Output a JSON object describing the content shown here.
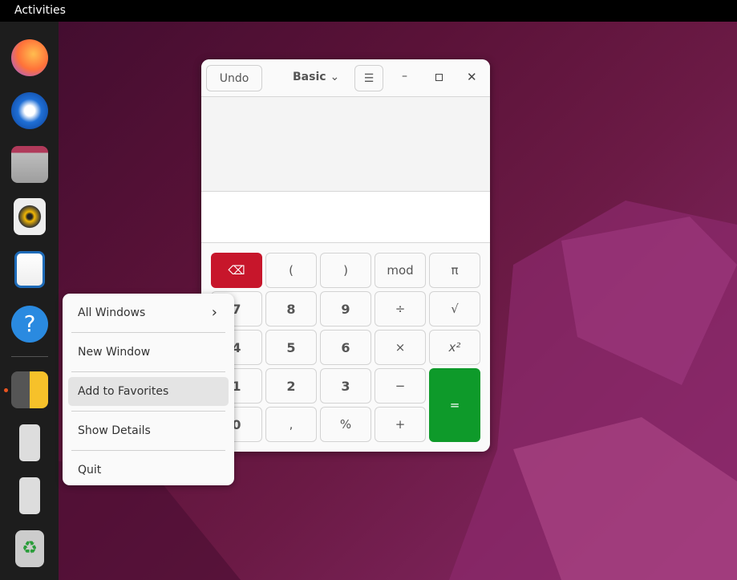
{
  "topbar": {
    "activities": "Activities"
  },
  "dock": {
    "items": [
      "firefox",
      "thunderbird",
      "files",
      "rhythmbox",
      "libreoffice-writer",
      "help",
      "calculator",
      "usb-drive",
      "usb-drive",
      "trash"
    ],
    "running_indicator_color": "#e95420"
  },
  "calculator": {
    "undo": "Undo",
    "mode": "Basic",
    "display": "",
    "input": "",
    "keys": [
      [
        "⌫",
        "(",
        ")",
        "mod",
        "π"
      ],
      [
        "7",
        "8",
        "9",
        "÷",
        "√"
      ],
      [
        "4",
        "5",
        "6",
        "×",
        "x²"
      ],
      [
        "1",
        "2",
        "3",
        "−",
        "="
      ],
      [
        "0",
        ",",
        "%",
        "+"
      ]
    ],
    "backspace_color": "#c7162b",
    "equals_color": "#0e9a2a"
  },
  "context_menu": {
    "items": [
      "All Windows",
      "New Window",
      "Add to Favorites",
      "Show Details",
      "Quit"
    ],
    "highlighted": "Add to Favorites"
  }
}
